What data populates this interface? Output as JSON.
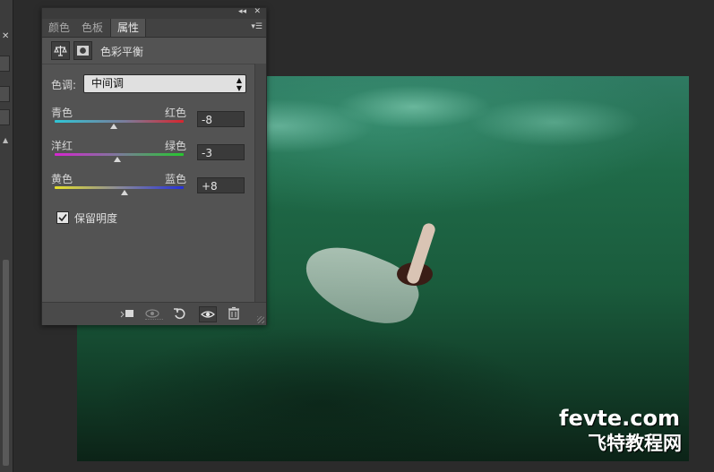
{
  "colors": {
    "panel_bg": "#535353",
    "app_bg": "#2b2b2b",
    "canvas_water": "#1a5b3c"
  },
  "panel": {
    "tabs": [
      {
        "label": "颜色"
      },
      {
        "label": "色板"
      },
      {
        "label": "属性"
      }
    ],
    "active_tab": "属性",
    "adjustment_title": "色彩平衡",
    "icons": [
      "balance-scale-icon",
      "mask-icon"
    ],
    "tone": {
      "label": "色调:",
      "value": "中间调"
    },
    "sliders": [
      {
        "left_label": "青色",
        "right_label": "红色",
        "value": "-8",
        "position": -8
      },
      {
        "left_label": "洋红",
        "right_label": "绿色",
        "value": "-3",
        "position": -3
      },
      {
        "left_label": "黄色",
        "right_label": "蓝色",
        "value": "+8",
        "position": 8
      }
    ],
    "preserve_luminosity": {
      "label": "保留明度",
      "checked": true
    },
    "bottom_icons": [
      "clip-to-layer-icon",
      "view-previous-state-icon",
      "reset-icon",
      "visibility-eye-icon",
      "delete-trash-icon"
    ]
  },
  "watermark": {
    "line1": "fevte.com",
    "line2": "飞特教程网"
  }
}
